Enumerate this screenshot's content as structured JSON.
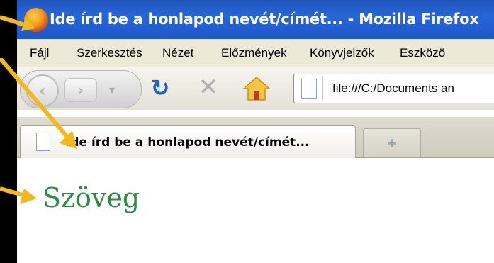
{
  "window": {
    "title": "Ide írd be a honlapod nevét/címét... - Mozilla Firefox"
  },
  "menu": {
    "items": [
      "Fájl",
      "Szerkesztés",
      "Nézet",
      "Előzmények",
      "Könyvjelzők",
      "Eszközö"
    ]
  },
  "toolbar": {
    "url": "file:///C:/Documents an"
  },
  "tabs": [
    {
      "label": "Ide írd be a honlapod nevét/címét..."
    }
  ],
  "page": {
    "text": "Szöveg"
  },
  "colors": {
    "arrow": "#f5b81c",
    "page_text": "#2e8b43",
    "titlebar": "#2766d8"
  }
}
